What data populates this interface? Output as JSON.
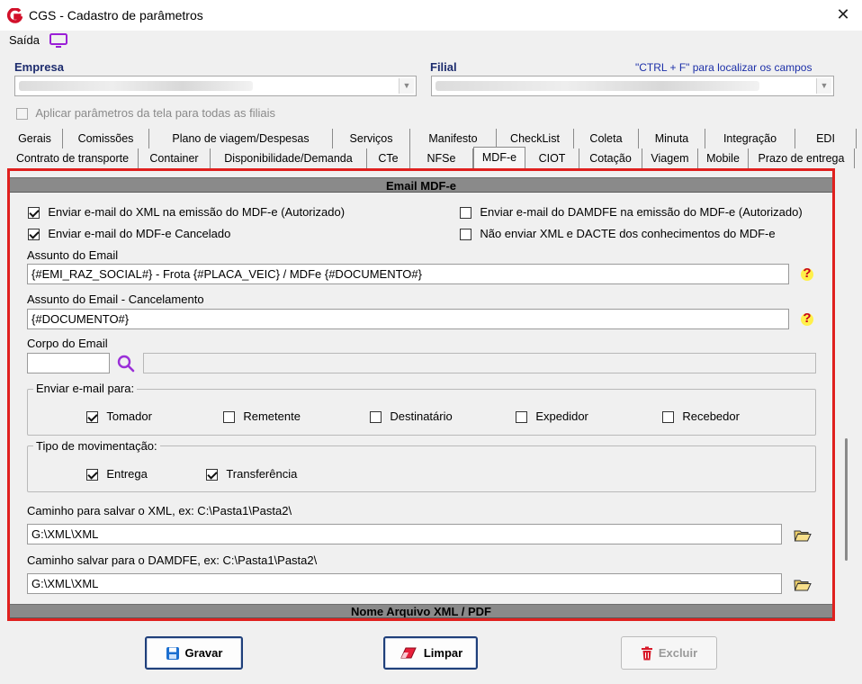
{
  "window": {
    "title": "CGS - Cadastro de parâmetros",
    "close": "✕"
  },
  "menu": {
    "saida": "Saída"
  },
  "empresa": {
    "label": "Empresa"
  },
  "filial": {
    "label": "Filial",
    "hint": "\"CTRL + F\" para localizar os campos"
  },
  "apply_all": {
    "label": "Aplicar parâmetros da tela para todas as filiais",
    "checked": false,
    "enabled": false
  },
  "tabs_row1": [
    "Gerais",
    "Comissões",
    "Plano de viagem/Despesas",
    "Serviços",
    "Manifesto",
    "CheckList",
    "Coleta",
    "Minuta",
    "Integração",
    "EDI"
  ],
  "tabs_row2": [
    "Contrato de transporte",
    "Container",
    "Disponibilidade/Demanda",
    "CTe",
    "NFSe",
    "MDF-e",
    "CIOT",
    "Cotação",
    "Viagem",
    "Mobile",
    "Prazo de entrega"
  ],
  "active_tab": "MDF-e",
  "section": {
    "title": "Email MDF-e",
    "chk_xml": {
      "label": "Enviar e-mail do XML na emissão do MDF-e (Autorizado)",
      "checked": true
    },
    "chk_cancel": {
      "label": "Enviar e-mail do MDF-e Cancelado",
      "checked": true
    },
    "chk_damdfe": {
      "label": "Enviar e-mail do DAMDFE na emissão do MDF-e (Autorizado)",
      "checked": false
    },
    "chk_nao_enviar": {
      "label": "Não enviar XML e DACTE dos conhecimentos do MDF-e",
      "checked": false
    },
    "assunto_label": "Assunto do Email",
    "assunto_value": "{#EMI_RAZ_SOCIAL#} - Frota {#PLACA_VEIC} / MDFe {#DOCUMENTO#}",
    "assunto_canc_label": "Assunto do Email - Cancelamento",
    "assunto_canc_value": "{#DOCUMENTO#}",
    "corpo_label": "Corpo do Email",
    "corpo_code": "",
    "corpo_desc": "",
    "enviar_para": {
      "title": "Enviar e-mail para:",
      "options": [
        {
          "label": "Tomador",
          "checked": true
        },
        {
          "label": "Remetente",
          "checked": false
        },
        {
          "label": "Destinatário",
          "checked": false
        },
        {
          "label": "Expedidor",
          "checked": false
        },
        {
          "label": "Recebedor",
          "checked": false
        }
      ]
    },
    "movimentacao": {
      "title": "Tipo de movimentação:",
      "options": [
        {
          "label": "Entrega",
          "checked": true
        },
        {
          "label": "Transferência",
          "checked": true
        }
      ]
    },
    "path_xml_label": "Caminho para salvar o XML, ex: C:\\Pasta1\\Pasta2\\",
    "path_xml_value": "G:\\XML\\XML",
    "path_damdfe_label": "Caminho salvar para o DAMDFE, ex: C:\\Pasta1\\Pasta2\\",
    "path_damdfe_value": "G:\\XML\\XML",
    "next_section": "Nome Arquivo XML / PDF"
  },
  "buttons": {
    "gravar": "Gravar",
    "limpar": "Limpar",
    "excluir": "Excluir"
  },
  "colors": {
    "accent_red": "#e0201e",
    "label_blue": "#1d2c6e",
    "hint_blue": "#1c2fa8"
  }
}
